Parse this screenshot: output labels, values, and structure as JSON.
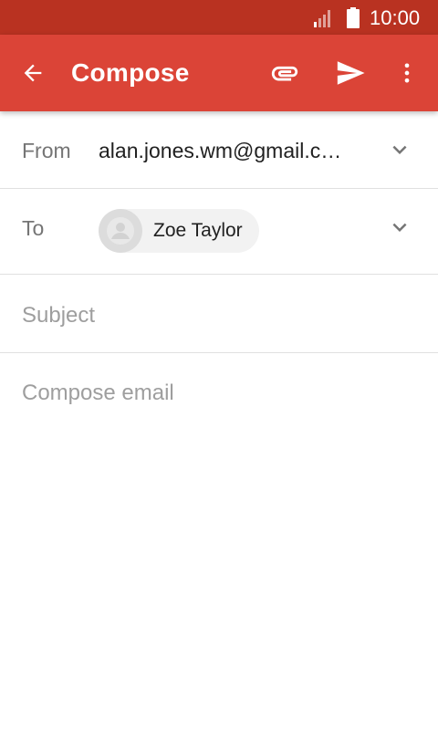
{
  "status_bar": {
    "time": "10:00",
    "signal_icon": "cellular-signal-icon",
    "battery_icon": "battery-icon",
    "background": "#b93221"
  },
  "app_bar": {
    "title": "Compose",
    "background": "#db4437",
    "icons": {
      "back": "arrow-back-icon",
      "attach": "paperclip-icon",
      "send": "send-icon",
      "more": "more-vert-icon"
    }
  },
  "form": {
    "from": {
      "label": "From",
      "value": "alan.jones.wm@gmail.c…"
    },
    "to": {
      "label": "To",
      "recipient": "Zoe Taylor"
    },
    "subject": {
      "placeholder": "Subject",
      "value": ""
    },
    "body": {
      "placeholder": "Compose email",
      "value": ""
    }
  },
  "colors": {
    "label": "#757575",
    "text": "#212121",
    "placeholder": "#9e9e9e",
    "divider": "#e0e0e0",
    "chip": "#f2f2f2"
  }
}
